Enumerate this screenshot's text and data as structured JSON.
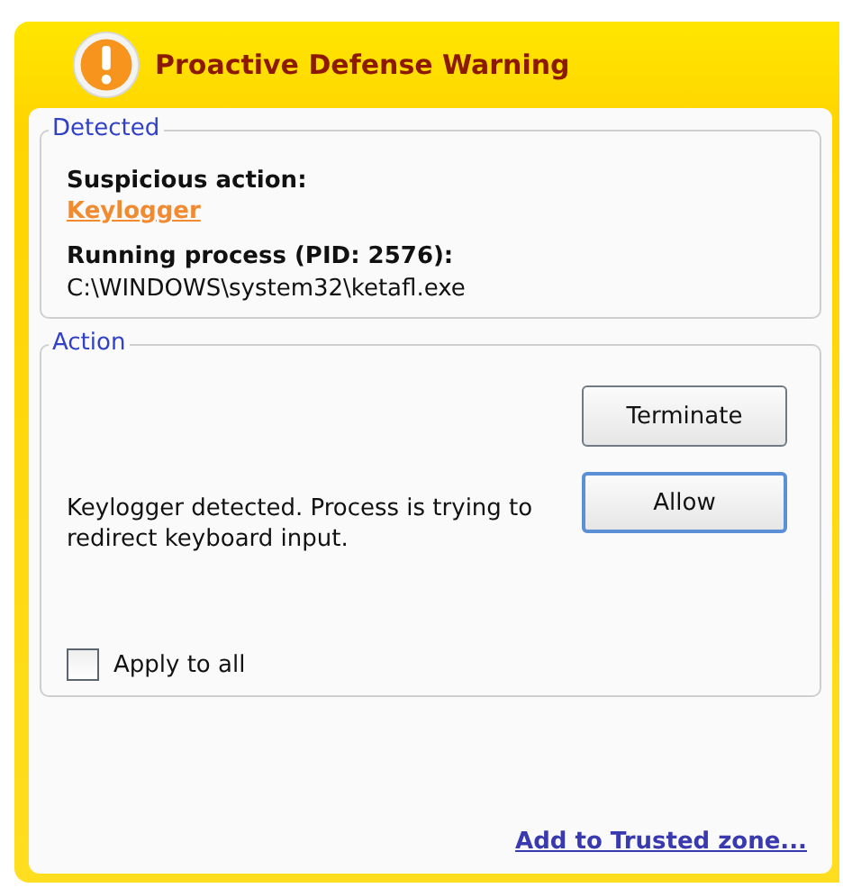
{
  "window": {
    "title": "Proactive Defense Warning"
  },
  "detected": {
    "legend": "Detected",
    "action_label": "Suspicious action:",
    "action_link": "Keylogger",
    "process_label": "Running process (PID: 2576):",
    "process_path": "C:\\WINDOWS\\system32\\ketafl.exe"
  },
  "action": {
    "legend": "Action",
    "message": "Keylogger detected. Process is trying to redirect keyboard input.",
    "buttons": [
      {
        "label": "Terminate",
        "default": false
      },
      {
        "label": "Allow",
        "default": true
      }
    ],
    "apply_to_all": {
      "label": "Apply to all",
      "checked": false
    }
  },
  "footer_link": "Add to Trusted zone..."
}
